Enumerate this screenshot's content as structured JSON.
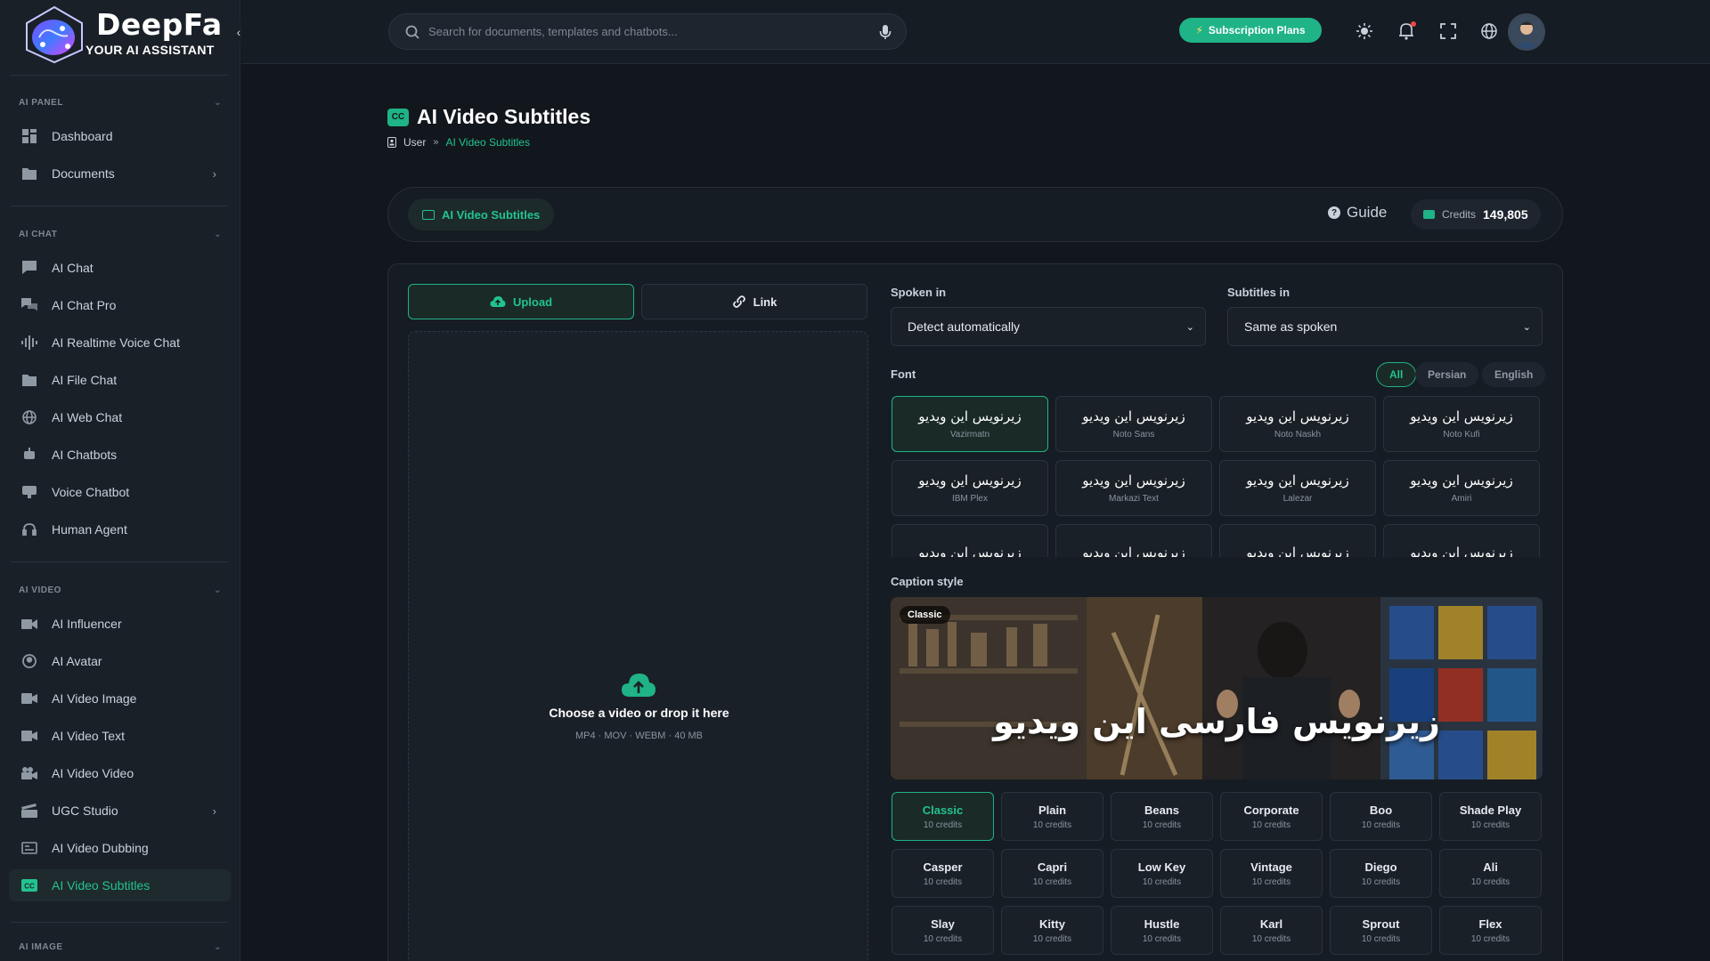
{
  "brand": {
    "name": "DeepFa",
    "tagline": "YOUR AI ASSISTANT",
    "accent": "#1fb387"
  },
  "sidebar": {
    "collapse_icon": "chevron-left-icon",
    "sections": [
      {
        "title": "AI PANEL",
        "items": [
          {
            "label": "Dashboard",
            "icon": "dashboard-icon"
          },
          {
            "label": "Documents",
            "icon": "folder-icon",
            "has_arrow": true
          }
        ]
      },
      {
        "title": "AI CHAT",
        "items": [
          {
            "label": "AI Chat",
            "icon": "chat-icon"
          },
          {
            "label": "AI Chat Pro",
            "icon": "chats-icon"
          },
          {
            "label": "AI Realtime Voice Chat",
            "icon": "waveform-icon"
          },
          {
            "label": "AI File Chat",
            "icon": "file-icon"
          },
          {
            "label": "AI Web Chat",
            "icon": "globe-icon"
          },
          {
            "label": "AI Chatbots",
            "icon": "bot-icon"
          },
          {
            "label": "Voice Chatbot",
            "icon": "voice-bot-icon"
          },
          {
            "label": "Human Agent",
            "icon": "headset-icon"
          }
        ]
      },
      {
        "title": "AI VIDEO",
        "items": [
          {
            "label": "AI Influencer",
            "icon": "camera-icon"
          },
          {
            "label": "AI Avatar",
            "icon": "avatar-icon"
          },
          {
            "label": "AI Video Image",
            "icon": "video-icon"
          },
          {
            "label": "AI Video Text",
            "icon": "video-text-icon"
          },
          {
            "label": "AI Video Video",
            "icon": "video-camera-icon"
          },
          {
            "label": "UGC Studio",
            "icon": "clapper-icon",
            "has_arrow": true
          },
          {
            "label": "AI Video Dubbing",
            "icon": "dubbing-icon"
          },
          {
            "label": "AI Video Subtitles",
            "icon": "cc-icon",
            "active": true
          }
        ]
      },
      {
        "title": "AI IMAGE",
        "items": []
      }
    ]
  },
  "topbar": {
    "search_placeholder": "Search for documents, templates and chatbots...",
    "subscription_label": "Subscription Plans",
    "icons": [
      "sun-icon",
      "bell-icon",
      "fullscreen-icon",
      "globe-icon"
    ]
  },
  "page": {
    "badge": "CC",
    "title": "AI Video Subtitles",
    "breadcrumb": {
      "root": "User",
      "current": "AI Video Subtitles"
    }
  },
  "tool_header": {
    "pill_label": "AI Video Subtitles",
    "guide_label": "Guide",
    "credits_label": "Credits",
    "credits_value": "149,805"
  },
  "upload": {
    "upload_tab": "Upload",
    "link_tab": "Link",
    "drop_title": "Choose a video or drop it here",
    "drop_sub": "MP4 · MOV · WEBM · 40 MB"
  },
  "settings": {
    "spoken_label": "Spoken in",
    "spoken_value": "Detect automatically",
    "subtitles_label": "Subtitles in",
    "subtitles_value": "Same as spoken",
    "font_label": "Font",
    "font_filters": [
      "All",
      "Persian",
      "English"
    ],
    "font_filter_active": 0,
    "fonts": [
      {
        "sample": "زیرنویس این ویدیو",
        "name": "Vazirmatn"
      },
      {
        "sample": "زیرنویس این ویدیو",
        "name": "Noto Sans"
      },
      {
        "sample": "زیرنویس این ویدیو",
        "name": "Noto Naskh"
      },
      {
        "sample": "زیرنویس این ویدیو",
        "name": "Noto Kufi"
      },
      {
        "sample": "زیرنویس این ویدیو",
        "name": "IBM Plex"
      },
      {
        "sample": "زیرنویس این ویدیو",
        "name": "Markazi Text"
      },
      {
        "sample": "زیرنویس این ویدیو",
        "name": "Lalezar"
      },
      {
        "sample": "زیرنویس این ویدیو",
        "name": "Amiri"
      },
      {
        "sample": "زیرنویس این ویدیو",
        "name": ""
      },
      {
        "sample": "زیرنویس این ویدیو",
        "name": ""
      },
      {
        "sample": "زیرنویس این ویدیو",
        "name": ""
      },
      {
        "sample": "زیرنویس این ویدیو",
        "name": ""
      }
    ],
    "font_active": 0,
    "caption_label": "Caption style",
    "preview_tag": "Classic",
    "preview_caption": "زیرنویس فارسی این ویدیو",
    "styles": [
      {
        "name": "Classic",
        "cost": "10 credits"
      },
      {
        "name": "Plain",
        "cost": "10 credits"
      },
      {
        "name": "Beans",
        "cost": "10 credits"
      },
      {
        "name": "Corporate",
        "cost": "10 credits"
      },
      {
        "name": "Boo",
        "cost": "10 credits"
      },
      {
        "name": "Shade Play",
        "cost": "10 credits"
      },
      {
        "name": "Casper",
        "cost": "10 credits"
      },
      {
        "name": "Capri",
        "cost": "10 credits"
      },
      {
        "name": "Low Key",
        "cost": "10 credits"
      },
      {
        "name": "Vintage",
        "cost": "10 credits"
      },
      {
        "name": "Diego",
        "cost": "10 credits"
      },
      {
        "name": "Ali",
        "cost": "10 credits"
      },
      {
        "name": "Slay",
        "cost": "10 credits"
      },
      {
        "name": "Kitty",
        "cost": "10 credits"
      },
      {
        "name": "Hustle",
        "cost": "10 credits"
      },
      {
        "name": "Karl",
        "cost": "10 credits"
      },
      {
        "name": "Sprout",
        "cost": "10 credits"
      },
      {
        "name": "Flex",
        "cost": "10 credits"
      }
    ],
    "style_active": 0
  }
}
